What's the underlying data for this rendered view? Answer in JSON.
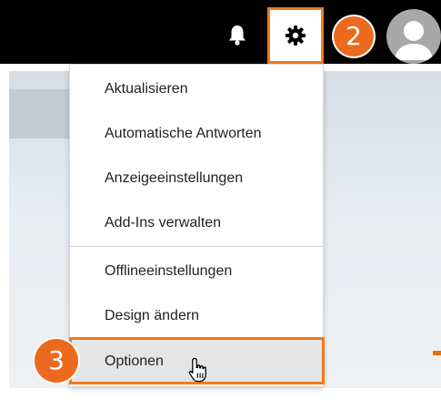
{
  "header": {
    "icons": [
      "bell-icon",
      "gear-icon",
      "avatar"
    ],
    "accent_color": "#f07a1d"
  },
  "steps": {
    "settings_step": "2",
    "options_step": "3"
  },
  "menu": {
    "items": [
      {
        "label": "Aktualisieren"
      },
      {
        "label": "Automatische Antworten"
      },
      {
        "label": "Anzeigeeinstellungen"
      },
      {
        "label": "Add-Ins verwalten"
      },
      {
        "label": "Offlineeinstellungen"
      },
      {
        "label": "Design ändern"
      },
      {
        "label": "Optionen",
        "highlighted": true
      }
    ]
  }
}
